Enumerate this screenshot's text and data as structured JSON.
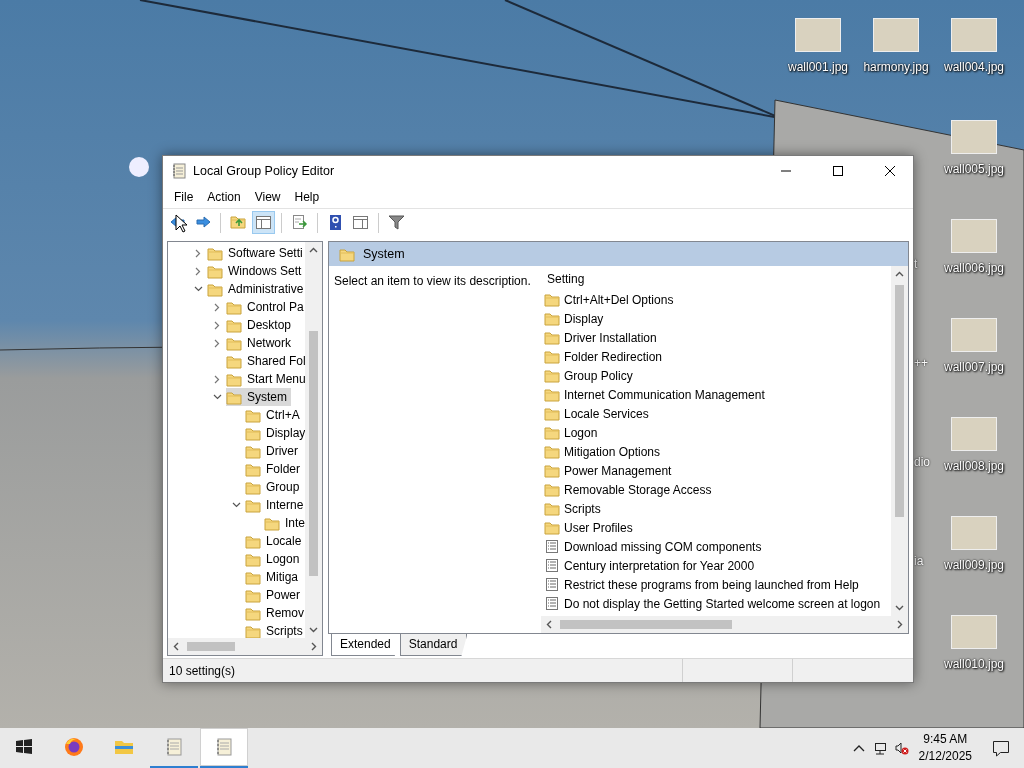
{
  "window": {
    "title": "Local Group Policy Editor"
  },
  "menu": [
    "File",
    "Action",
    "View",
    "Help"
  ],
  "toolbar": [
    {
      "kind": "back",
      "pressed": false
    },
    {
      "kind": "forward",
      "pressed": false
    },
    {
      "kind": "separator"
    },
    {
      "kind": "up",
      "pressed": false
    },
    {
      "kind": "tree",
      "pressed": true
    },
    {
      "kind": "separator"
    },
    {
      "kind": "export",
      "pressed": false
    },
    {
      "kind": "separator"
    },
    {
      "kind": "help",
      "pressed": false
    },
    {
      "kind": "action_pane",
      "pressed": false
    },
    {
      "kind": "separator"
    },
    {
      "kind": "filter",
      "pressed": false
    }
  ],
  "tree": [
    {
      "label": "Software Setti",
      "expandable": true,
      "expanded": false,
      "selected": false
    },
    {
      "label": "Windows Sett",
      "expandable": true,
      "expanded": false,
      "selected": false
    },
    {
      "label": "Administrative",
      "expandable": true,
      "expanded": true,
      "selected": false,
      "children": [
        {
          "label": "Control Pa",
          "expandable": true,
          "expanded": false,
          "selected": false
        },
        {
          "label": "Desktop",
          "expandable": true,
          "expanded": false,
          "selected": false
        },
        {
          "label": "Network",
          "expandable": true,
          "expanded": false,
          "selected": false
        },
        {
          "label": "Shared Fol",
          "expandable": false,
          "selected": false
        },
        {
          "label": "Start Menu",
          "expandable": true,
          "expanded": false,
          "selected": false
        },
        {
          "label": "System",
          "expandable": true,
          "expanded": true,
          "selected": true,
          "children": [
            {
              "label": "Ctrl+A",
              "expandable": false,
              "selected": false
            },
            {
              "label": "Display",
              "expandable": false,
              "selected": false
            },
            {
              "label": "Driver",
              "expandable": false,
              "selected": false
            },
            {
              "label": "Folder",
              "expandable": false,
              "selected": false
            },
            {
              "label": "Group",
              "expandable": false,
              "selected": false
            },
            {
              "label": "Interne",
              "expandable": true,
              "expanded": true,
              "selected": false,
              "children": [
                {
                  "label": "Inte",
                  "expandable": false,
                  "selected": false
                }
              ]
            },
            {
              "label": "Locale",
              "expandable": false,
              "selected": false
            },
            {
              "label": "Logon",
              "expandable": false,
              "selected": false
            },
            {
              "label": "Mitiga",
              "expandable": false,
              "selected": false
            },
            {
              "label": "Power",
              "expandable": false,
              "selected": false
            },
            {
              "label": "Remov",
              "expandable": false,
              "selected": false
            },
            {
              "label": "Scripts",
              "expandable": false,
              "selected": false
            }
          ]
        }
      ]
    }
  ],
  "pane_title": "System",
  "description": "Select an item to view its description.",
  "list": {
    "header": "Setting",
    "rows": [
      {
        "kind": "folder",
        "label": "Ctrl+Alt+Del Options"
      },
      {
        "kind": "folder",
        "label": "Display"
      },
      {
        "kind": "folder",
        "label": "Driver Installation"
      },
      {
        "kind": "folder",
        "label": "Folder Redirection"
      },
      {
        "kind": "folder",
        "label": "Group Policy"
      },
      {
        "kind": "folder",
        "label": "Internet Communication Management"
      },
      {
        "kind": "folder",
        "label": "Locale Services"
      },
      {
        "kind": "folder",
        "label": "Logon"
      },
      {
        "kind": "folder",
        "label": "Mitigation Options"
      },
      {
        "kind": "folder",
        "label": "Power Management"
      },
      {
        "kind": "folder",
        "label": "Removable Storage Access"
      },
      {
        "kind": "folder",
        "label": "Scripts"
      },
      {
        "kind": "folder",
        "label": "User Profiles"
      },
      {
        "kind": "policy",
        "label": "Download missing COM components"
      },
      {
        "kind": "policy",
        "label": "Century interpretation for Year 2000"
      },
      {
        "kind": "policy",
        "label": "Restrict these programs from being launched from Help"
      },
      {
        "kind": "policy",
        "label": "Do not display the Getting Started welcome screen at logon"
      }
    ]
  },
  "view_tabs": [
    {
      "label": "Extended",
      "selected": true
    },
    {
      "label": "Standard",
      "selected": false
    }
  ],
  "status_bar": "10 setting(s)",
  "desktop_icons": [
    {
      "label": "wall001.jpg"
    },
    {
      "label": "harmony.jpg"
    },
    {
      "label": "wall004.jpg"
    },
    {
      "label": "wall005.jpg"
    },
    {
      "label": "wall006.jpg"
    },
    {
      "label": "wall007.jpg"
    },
    {
      "label": "wall008.jpg"
    },
    {
      "label": "wall009.jpg"
    },
    {
      "label": "wall010.jpg"
    }
  ],
  "hidden_icon_labels": [
    "t",
    "++",
    "dio",
    "ia"
  ],
  "taskbar": {
    "apps": [
      {
        "kind": "start",
        "running": false,
        "active": false
      },
      {
        "kind": "firefox",
        "running": false,
        "active": false
      },
      {
        "kind": "explorer",
        "running": false,
        "active": false
      },
      {
        "kind": "notepad",
        "running": true,
        "active": false
      },
      {
        "kind": "notepad",
        "running": true,
        "active": true
      }
    ],
    "time": "9:45 AM",
    "date": "2/12/2025"
  }
}
